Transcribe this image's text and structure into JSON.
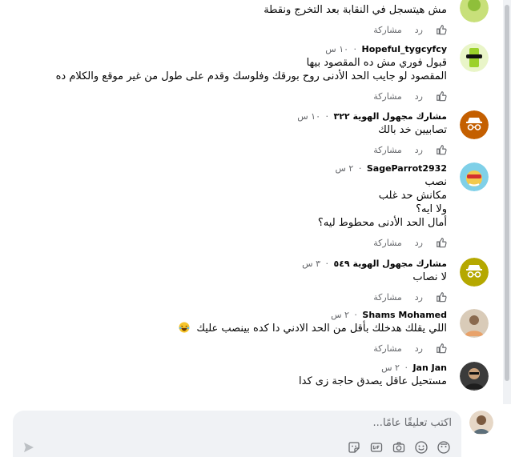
{
  "actions": {
    "share_label": "مشاركة",
    "reply_label": "رد"
  },
  "comments": [
    {
      "author": "",
      "time": "",
      "lines": [
        "مش هيتسجل في النقابة بعد التخرج ونقطة"
      ],
      "avatar": "avatar-partial"
    },
    {
      "author": "Hopeful_tygcyfcy",
      "time": "١٠ س",
      "lines": [
        "قبول فوري مش ده المقصود بيها",
        "المقصود لو جايب الحد الأدنى روح بورقك وفلوسك وقدم على طول من غير موقع والكلام ده"
      ],
      "avatar": "avatar-green-sunglasses"
    },
    {
      "author": "مشارك مجهول الهوية ٣٢٢",
      "time": "١٠ س",
      "lines": [
        "تصابيين خد بالك"
      ],
      "avatar": "anonymous-icon"
    },
    {
      "author": "SageParrot2932",
      "time": "٢ س",
      "lines": [
        "نصب",
        "مكانش حد غلب",
        "ولا ايه؟",
        "أمال الحد الأدنى محطوط ليه؟"
      ],
      "avatar": "avatar-sunglasses"
    },
    {
      "author": "مشارك مجهول الهوية ٥٤٩",
      "time": "٣ س",
      "lines": [
        "لا نصاب"
      ],
      "avatar": "anonymous-icon"
    },
    {
      "author": "Shams Mohamed",
      "time": "٢ س",
      "lines": [
        "اللي يقلك هدخلك بأقل من الحد الادني دا كده بينصب عليك"
      ],
      "avatar": "avatar-photo"
    },
    {
      "author": "Jan Jan",
      "time": "٢ س",
      "lines": [
        "مستحيل عاقل يصدق حاجة زى كدا"
      ],
      "avatar": "avatar-photo"
    }
  ],
  "composer": {
    "placeholder": "اكتب تعليقًا عامًا..."
  },
  "colors": {
    "meta": "#65676b",
    "composer_bg": "#f0f2f5",
    "anonymous_avatar": "#c45f00"
  }
}
